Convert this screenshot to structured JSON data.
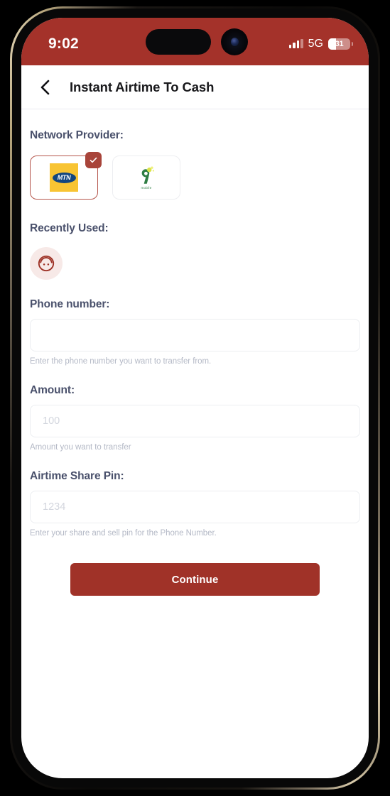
{
  "status_bar": {
    "time": "9:02",
    "network_type": "5G",
    "battery_level": "31",
    "signal_icon": "cellular-signal-icon",
    "battery_icon": "battery-icon"
  },
  "header": {
    "back_icon": "chevron-left-icon",
    "title": "Instant Airtime To Cash"
  },
  "network_provider": {
    "label": "Network Provider:",
    "check_icon": "check-icon",
    "options": [
      {
        "id": "mtn",
        "name": "MTN",
        "logo_text": "MTN",
        "selected": true
      },
      {
        "id": "9mobile",
        "name": "9mobile",
        "logo_text": "mobile",
        "selected": false
      }
    ]
  },
  "recently_used": {
    "label": "Recently Used:",
    "contacts": [
      {
        "id": "recent-1",
        "icon": "contact-face-icon"
      }
    ]
  },
  "fields": {
    "phone_number": {
      "label": "Phone number:",
      "value": "",
      "placeholder": "",
      "help": "Enter the phone number you want to transfer from."
    },
    "amount": {
      "label": "Amount:",
      "value": "",
      "placeholder": "100",
      "help": "Amount you want to transfer"
    },
    "share_pin": {
      "label": "Airtime Share Pin:",
      "value": "",
      "placeholder": "1234",
      "help": "Enter your share and sell pin for the Phone Number."
    }
  },
  "actions": {
    "continue_label": "Continue"
  },
  "colors": {
    "brand_red": "#a03228",
    "status_bar_red": "#a4322a",
    "selected_border": "#b5564c",
    "label_text": "#49506b",
    "help_text": "#b4b9c6",
    "mtn_yellow": "#f8c433",
    "mtn_blue": "#12457f",
    "ninemobile_green": "#2e7d43"
  }
}
